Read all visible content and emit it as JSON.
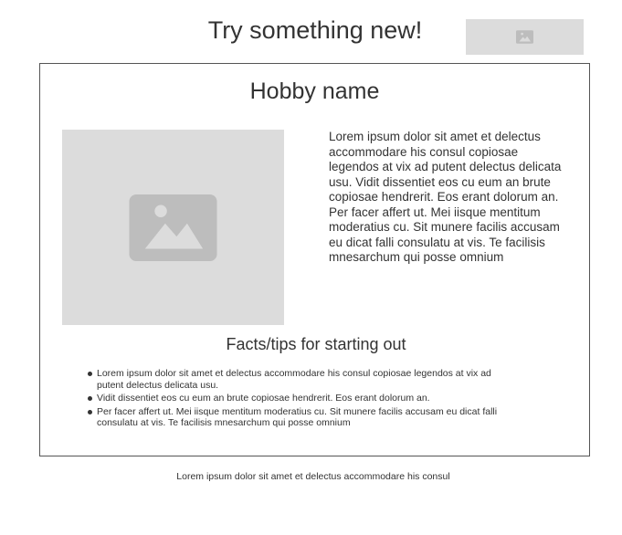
{
  "header": {
    "title": "Try something new!",
    "image_icon": "image-placeholder-icon"
  },
  "card": {
    "title": "Hobby name",
    "image_icon": "image-placeholder-icon",
    "description": "Lorem ipsum dolor sit amet et delectus accommodare his consul copiosae legendos at vix ad putent delectus delicata usu. Vidit dissentiet eos cu eum an brute copiosae hendrerit. Eos erant dolorum an. Per facer affert ut. Mei iisque mentitum moderatius cu. Sit munere facilis accusam eu dicat falli consulatu at vis. Te facilisis mnesarchum qui posse omnium",
    "facts_heading": "Facts/tips for starting out",
    "tips": [
      "Lorem ipsum dolor sit amet et delectus accommodare his consul copiosae legendos at vix ad putent delectus delicata usu.",
      "Vidit dissentiet eos cu eum an brute copiosae hendrerit. Eos erant dolorum an.",
      "Per facer affert ut. Mei iisque mentitum moderatius cu. Sit munere facilis accusam eu dicat falli consulatu at vis. Te facilisis mnesarchum qui posse omnium"
    ]
  },
  "footer": {
    "text": "Lorem ipsum dolor sit amet et delectus accommodare his consul"
  },
  "colors": {
    "placeholder_bg": "#dcdcdc",
    "placeholder_icon": "#bdbdbd",
    "text": "#333333",
    "border": "#555555"
  }
}
